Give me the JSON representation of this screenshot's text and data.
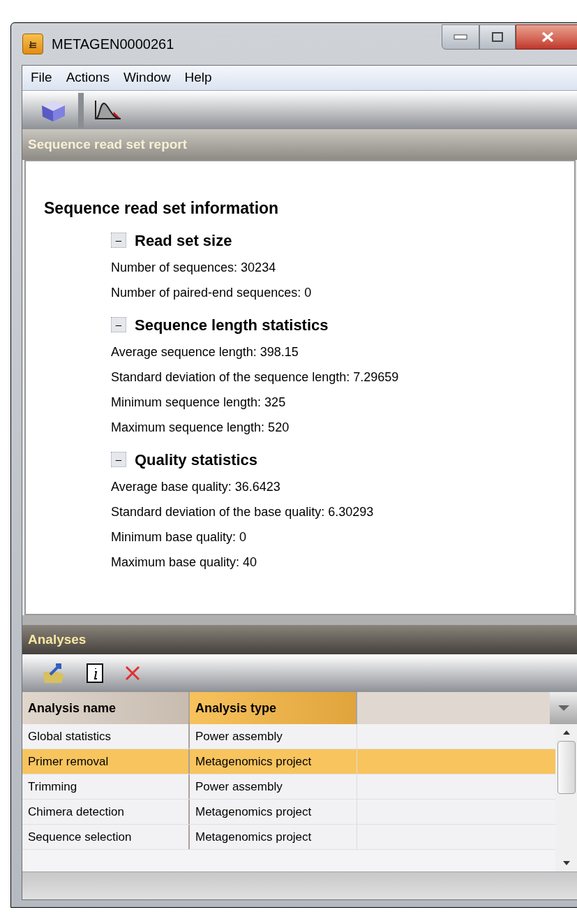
{
  "window": {
    "title": "METAGEN0000261"
  },
  "menu": [
    "File",
    "Actions",
    "Window",
    "Help"
  ],
  "report": {
    "header": "Sequence read set report",
    "title": "Sequence read set information",
    "sections": [
      {
        "toggle": "–",
        "heading": "Read set size",
        "expanded": true,
        "lines": [
          "Number of sequences: 30234",
          "Number of paired-end sequences: 0"
        ]
      },
      {
        "toggle": "–",
        "heading": "Sequence length statistics",
        "expanded": true,
        "lines": [
          "Average sequence length: 398.15",
          "Standard deviation of the sequence length: 7.29659",
          "Minimum sequence length: 325",
          "Maximum sequence length: 520"
        ]
      },
      {
        "toggle": "–",
        "heading": "Quality statistics",
        "expanded": true,
        "lines": [
          "Average base quality: 36.6423",
          "Standard deviation of the base quality: 6.30293",
          "Minimum base quality: 0",
          "Maximum base quality: 40"
        ]
      }
    ]
  },
  "analyses": {
    "header": "Analyses",
    "columns": [
      {
        "label": "Analysis name",
        "selected": false
      },
      {
        "label": "Analysis type",
        "selected": true
      }
    ],
    "rows": [
      {
        "cells": [
          "Global statistics",
          "Power assembly"
        ],
        "selected": false
      },
      {
        "cells": [
          "Primer removal",
          "Metagenomics project"
        ],
        "selected": true
      },
      {
        "cells": [
          "Trimming",
          "Power assembly"
        ],
        "selected": false
      },
      {
        "cells": [
          "Chimera detection",
          "Metagenomics project"
        ],
        "selected": false
      },
      {
        "cells": [
          "Sequence selection",
          "Metagenomics project"
        ],
        "selected": false
      }
    ]
  }
}
